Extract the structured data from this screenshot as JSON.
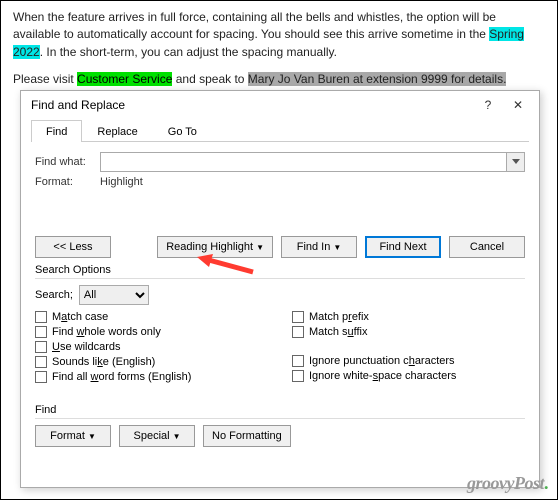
{
  "doc": {
    "p1_a": "When the feature arrives in full force, containing all the bells and whistles, the option will be available to automatically account for spacing. You should see this arrive sometime in the ",
    "p1_hl": "Spring 2022",
    "p1_b": ". In the short-term, you can adjust the spacing manually.",
    "p2_a": "Please visit ",
    "p2_hl1": "Customer Service",
    "p2_b": " and speak to ",
    "p2_hl2": "Mary Jo Van Buren at extension 9999",
    "p2_c": " for details."
  },
  "dialog": {
    "title": "Find and Replace",
    "help": "?",
    "close": "✕",
    "tabs": {
      "find": "Find",
      "replace": "Replace",
      "goto": "Go To"
    },
    "find_what_label": "Find what:",
    "format_label": "Format:",
    "format_value": "Highlight",
    "buttons": {
      "less": "<<  Less",
      "reading_highlight": "Reading Highlight",
      "find_in": "Find In",
      "find_next": "Find Next",
      "cancel": "Cancel"
    },
    "search_options_title": "Search Options",
    "search_label": "Search;",
    "search_value": "All",
    "checks_left": [
      {
        "pre": "M",
        "u": "a",
        "post": "tch case"
      },
      {
        "pre": "Find ",
        "u": "w",
        "post": "hole words only"
      },
      {
        "pre": "",
        "u": "U",
        "post": "se wildcards"
      },
      {
        "pre": "Sounds li",
        "u": "k",
        "post": "e (English)"
      },
      {
        "pre": "Find all ",
        "u": "w",
        "post": "ord forms (English)"
      }
    ],
    "checks_right": [
      {
        "pre": "Match p",
        "u": "r",
        "post": "efix"
      },
      {
        "pre": "Match s",
        "u": "u",
        "post": "ffix"
      },
      {
        "pre": "Ignore punctuation c",
        "u": "h",
        "post": "aracters"
      },
      {
        "pre": "Ignore white-",
        "u": "s",
        "post": "pace characters"
      }
    ],
    "find_section_title": "Find",
    "bottom": {
      "format": "Format",
      "special": "Special",
      "no_formatting": "No Formatting"
    }
  },
  "watermark": "groovyPost"
}
